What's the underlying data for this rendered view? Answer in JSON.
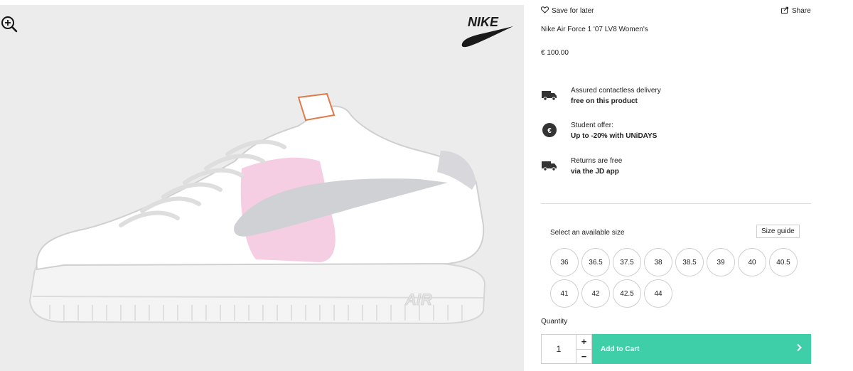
{
  "gallery": {
    "zoom_icon": "zoom-in-icon",
    "brand_logo_text": "NIKE"
  },
  "actions": {
    "save_label": "Save for later",
    "share_label": "Share"
  },
  "product": {
    "title": "Nike Air Force 1 '07 LV8 Women's",
    "price": "€ 100.00"
  },
  "features": [
    {
      "icon": "delivery-truck-icon",
      "line1": "Assured contactless delivery",
      "line2": "free on this product"
    },
    {
      "icon": "euro-coin-icon",
      "line1": "Student offer:",
      "line2": "Up to -20% with UNiDAYS"
    },
    {
      "icon": "delivery-truck-icon",
      "line1": "Returns are free",
      "line2": "via the JD app"
    }
  ],
  "size_section": {
    "label": "Select an available size",
    "guide_label": "Size guide",
    "sizes": [
      "36",
      "36.5",
      "37.5",
      "38",
      "38.5",
      "39",
      "40",
      "40.5",
      "41",
      "42",
      "42.5",
      "44"
    ]
  },
  "quantity": {
    "label": "Quantity",
    "value": "1",
    "plus": "+",
    "minus": "−"
  },
  "cart": {
    "label": "Add to Cart",
    "arrow": "›"
  },
  "colors": {
    "accent": "#3ecfa8",
    "swoosh_pink": "#f3c6de"
  }
}
